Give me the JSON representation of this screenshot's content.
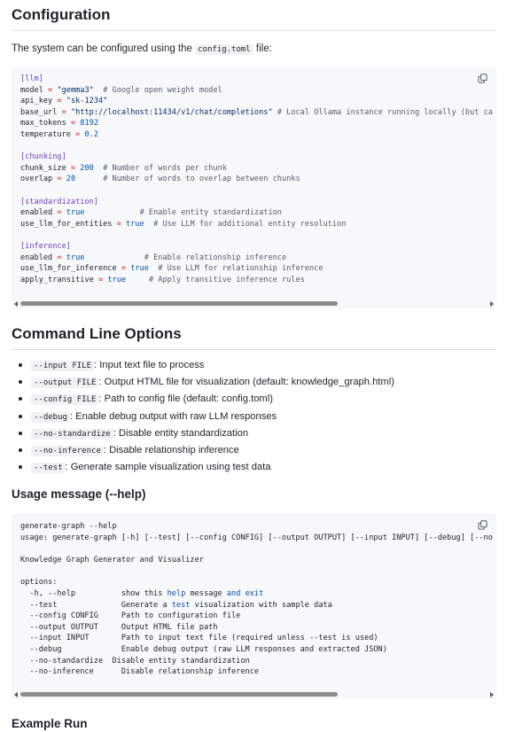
{
  "config_section": {
    "heading": "Configuration",
    "intro_prefix": "The system can be configured using the ",
    "intro_code": "config.toml",
    "intro_suffix": " file:",
    "lines": [
      [
        [
          "sec",
          "[llm]"
        ]
      ],
      [
        [
          "t",
          "model "
        ],
        [
          "op",
          "="
        ],
        [
          "t",
          " "
        ],
        [
          "str",
          "\"gemma3\""
        ],
        [
          "t",
          "  "
        ],
        [
          "cm",
          "# Google open weight model"
        ]
      ],
      [
        [
          "t",
          "api_key "
        ],
        [
          "op",
          "="
        ],
        [
          "t",
          " "
        ],
        [
          "str",
          "\"sk-1234\""
        ]
      ],
      [
        [
          "t",
          "base_url "
        ],
        [
          "op",
          "="
        ],
        [
          "t",
          " "
        ],
        [
          "str",
          "\"http://localhost:11434/v1/chat/completions\""
        ],
        [
          "t",
          " "
        ],
        [
          "cm",
          "# Local Ollama instance running locally (but ca"
        ]
      ],
      [
        [
          "t",
          "max_tokens "
        ],
        [
          "op",
          "="
        ],
        [
          "t",
          " "
        ],
        [
          "num",
          "8192"
        ]
      ],
      [
        [
          "t",
          "temperature "
        ],
        [
          "op",
          "="
        ],
        [
          "t",
          " "
        ],
        [
          "num",
          "0.2"
        ]
      ],
      [
        [
          "t",
          ""
        ]
      ],
      [
        [
          "sec",
          "[chunking]"
        ]
      ],
      [
        [
          "t",
          "chunk_size "
        ],
        [
          "op",
          "="
        ],
        [
          "t",
          " "
        ],
        [
          "num",
          "200"
        ],
        [
          "t",
          "  "
        ],
        [
          "cm",
          "# Number of words per chunk"
        ]
      ],
      [
        [
          "t",
          "overlap "
        ],
        [
          "op",
          "="
        ],
        [
          "t",
          " "
        ],
        [
          "num",
          "20"
        ],
        [
          "t",
          "      "
        ],
        [
          "cm",
          "# Number of words to overlap between chunks"
        ]
      ],
      [
        [
          "t",
          ""
        ]
      ],
      [
        [
          "sec",
          "[standardization]"
        ]
      ],
      [
        [
          "t",
          "enabled "
        ],
        [
          "op",
          "="
        ],
        [
          "t",
          " "
        ],
        [
          "kw",
          "true"
        ],
        [
          "t",
          "            "
        ],
        [
          "cm",
          "# Enable entity standardization"
        ]
      ],
      [
        [
          "t",
          "use_llm_for_entities "
        ],
        [
          "op",
          "="
        ],
        [
          "t",
          " "
        ],
        [
          "kw",
          "true"
        ],
        [
          "t",
          "  "
        ],
        [
          "cm",
          "# Use LLM for additional entity resolution"
        ]
      ],
      [
        [
          "t",
          ""
        ]
      ],
      [
        [
          "sec",
          "[inference]"
        ]
      ],
      [
        [
          "t",
          "enabled "
        ],
        [
          "op",
          "="
        ],
        [
          "t",
          " "
        ],
        [
          "kw",
          "true"
        ],
        [
          "t",
          "             "
        ],
        [
          "cm",
          "# Enable relationship inference"
        ]
      ],
      [
        [
          "t",
          "use_llm_for_inference "
        ],
        [
          "op",
          "="
        ],
        [
          "t",
          " "
        ],
        [
          "kw",
          "true"
        ],
        [
          "t",
          "  "
        ],
        [
          "cm",
          "# Use LLM for relationship inference"
        ]
      ],
      [
        [
          "t",
          "apply_transitive "
        ],
        [
          "op",
          "="
        ],
        [
          "t",
          " "
        ],
        [
          "kw",
          "true"
        ],
        [
          "t",
          "     "
        ],
        [
          "cm",
          "# Apply transitive inference rules"
        ]
      ]
    ],
    "scroll_fraction": 0.68
  },
  "cli_section": {
    "heading": "Command Line Options",
    "options": [
      {
        "flag": "--input FILE",
        "desc": ": Input text file to process"
      },
      {
        "flag": "--output FILE",
        "desc": ": Output HTML file for visualization (default: knowledge_graph.html)"
      },
      {
        "flag": "--config FILE",
        "desc": ": Path to config file (default: config.toml)"
      },
      {
        "flag": "--debug",
        "desc": ": Enable debug output with raw LLM responses"
      },
      {
        "flag": "--no-standardize",
        "desc": ": Disable entity standardization"
      },
      {
        "flag": "--no-inference",
        "desc": ": Disable relationship inference"
      },
      {
        "flag": "--test",
        "desc": ": Generate sample visualization using test data"
      }
    ]
  },
  "usage_section": {
    "heading": "Usage message (--help)",
    "lines": [
      [
        [
          "t",
          "generate-graph --help"
        ]
      ],
      [
        [
          "t",
          "usage: generate-graph [-h] [--test] [--config CONFIG] [--output OUTPUT] [--input INPUT] [--debug] [--no"
        ]
      ],
      [
        [
          "t",
          ""
        ]
      ],
      [
        [
          "t",
          "Knowledge Graph Generator and Visualizer"
        ]
      ],
      [
        [
          "t",
          ""
        ]
      ],
      [
        [
          "t",
          "options:"
        ]
      ],
      [
        [
          "t",
          "  -h, --help          show this "
        ],
        [
          "kw",
          "help"
        ],
        [
          "t",
          " message "
        ],
        [
          "kw",
          "and"
        ],
        [
          "t",
          " "
        ],
        [
          "kw",
          "exit"
        ]
      ],
      [
        [
          "t",
          "  --test              Generate a "
        ],
        [
          "kw",
          "test"
        ],
        [
          "t",
          " visualization with sample data"
        ]
      ],
      [
        [
          "t",
          "  --config CONFIG     Path to configuration file"
        ]
      ],
      [
        [
          "t",
          "  --output OUTPUT     Output HTML file path"
        ]
      ],
      [
        [
          "t",
          "  --input INPUT       Path to input text file (required unless --test is used)"
        ]
      ],
      [
        [
          "t",
          "  --debug             Enable debug output (raw LLM responses and extracted JSON)"
        ]
      ],
      [
        [
          "t",
          "  --no-standardize  Disable entity standardization"
        ]
      ],
      [
        [
          "t",
          "  --no-inference      Disable relationship inference"
        ]
      ]
    ],
    "scroll_fraction": 0.68
  },
  "example_section": {
    "heading": "Example Run"
  }
}
